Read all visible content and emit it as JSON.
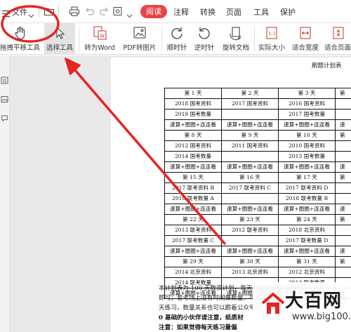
{
  "menubar": {
    "file_label": "文件",
    "reading_tab": "阅读",
    "tabs": [
      "注释",
      "转换",
      "页面",
      "工具",
      "保护"
    ]
  },
  "ribbon": {
    "tools": [
      "拖拽平移工具",
      "选择工具",
      "转为Word",
      "PDF转图片",
      "顺时针",
      "逆时针",
      "旋转文档",
      "实际大小",
      "适合宽度",
      "适合页面"
    ]
  },
  "document": {
    "heading": "刷题计划表",
    "table": {
      "rows": [
        [
          "第 1 天",
          "第 2 天",
          "第 3 天",
          "第"
        ],
        [
          "2018 国考资料",
          "2017 国考资料",
          "2016 国考资料",
          ""
        ],
        [
          "2018 国考数量",
          "",
          "2017 国考数量",
          ""
        ],
        [
          "速算+圈圈+连连看",
          "速算+圈圈+连连看",
          "速算+圈圈+连连看",
          "速"
        ],
        [
          "第 8 天",
          "第 9 天",
          "第 10 天",
          "第"
        ],
        [
          "2012 国考资料",
          "2011 国考资料",
          "2010 国考资料",
          ""
        ],
        [
          "2014 国考数量",
          "",
          "2013 国考数量",
          ""
        ],
        [
          "速算+圈圈+连连看",
          "速算+圈圈+连连看",
          "速算+圈圈+连连看",
          "速"
        ],
        [
          "第 15 天",
          "第 16 天",
          "第 17 天",
          "第"
        ],
        [
          "2017 联考资料 B",
          "2017 联考资料 C",
          "2017 联考资料 D",
          ""
        ],
        [
          "2018 联考数量 A",
          "",
          "2018 联考数量 B",
          ""
        ],
        [
          "速算+圈圈+连连看",
          "速算+圈圈+连连看",
          "速算+圈圈+连连看",
          "速"
        ],
        [
          "第 22 天",
          "第 23 天",
          "第 24 天",
          "第"
        ],
        [
          "2013 联考资料",
          "2012 联考资料",
          "2018 北京资料",
          ""
        ],
        [
          "2017 联考数量 C",
          "",
          "2017 联考数量 D",
          ""
        ],
        [
          "速算+圈圈+连连看",
          "速算+圈圈+连连看",
          "速算+圈圈+连连看",
          "速"
        ],
        [
          "第 29 天",
          "第 30 天",
          "第 31 天",
          "第"
        ],
        [
          "2014 北京资料",
          "2013 北京资料",
          "2012 北京资料",
          ""
        ],
        [
          "2014 联考数量",
          "",
          "2013 联考数量",
          ""
        ],
        [
          "速算+圈圈+连连看",
          "速算+圈圈+连连看",
          "速算+圈圈+连连看",
          "速"
        ]
      ]
    },
    "paragraphs": [
      "本计划表为 100 天数资计划，每天完成全部练习的时间大约在 1-1.",
      "即可；若考场上没有时间做数量，可适当减少数量专项套题练习（做数",
      "天练习，数量关系也可以跟着公众号的"
    ],
    "bold_lines": [
      "0 基础的小伙伴请注意，纸质材",
      "注意：如果觉得每天练习量偏"
    ]
  },
  "watermark": {
    "title": "大百网",
    "url": "www.big100.net"
  },
  "colors": {
    "annotation_red": "#e52521",
    "reading_tab_bg": "#e64548"
  }
}
